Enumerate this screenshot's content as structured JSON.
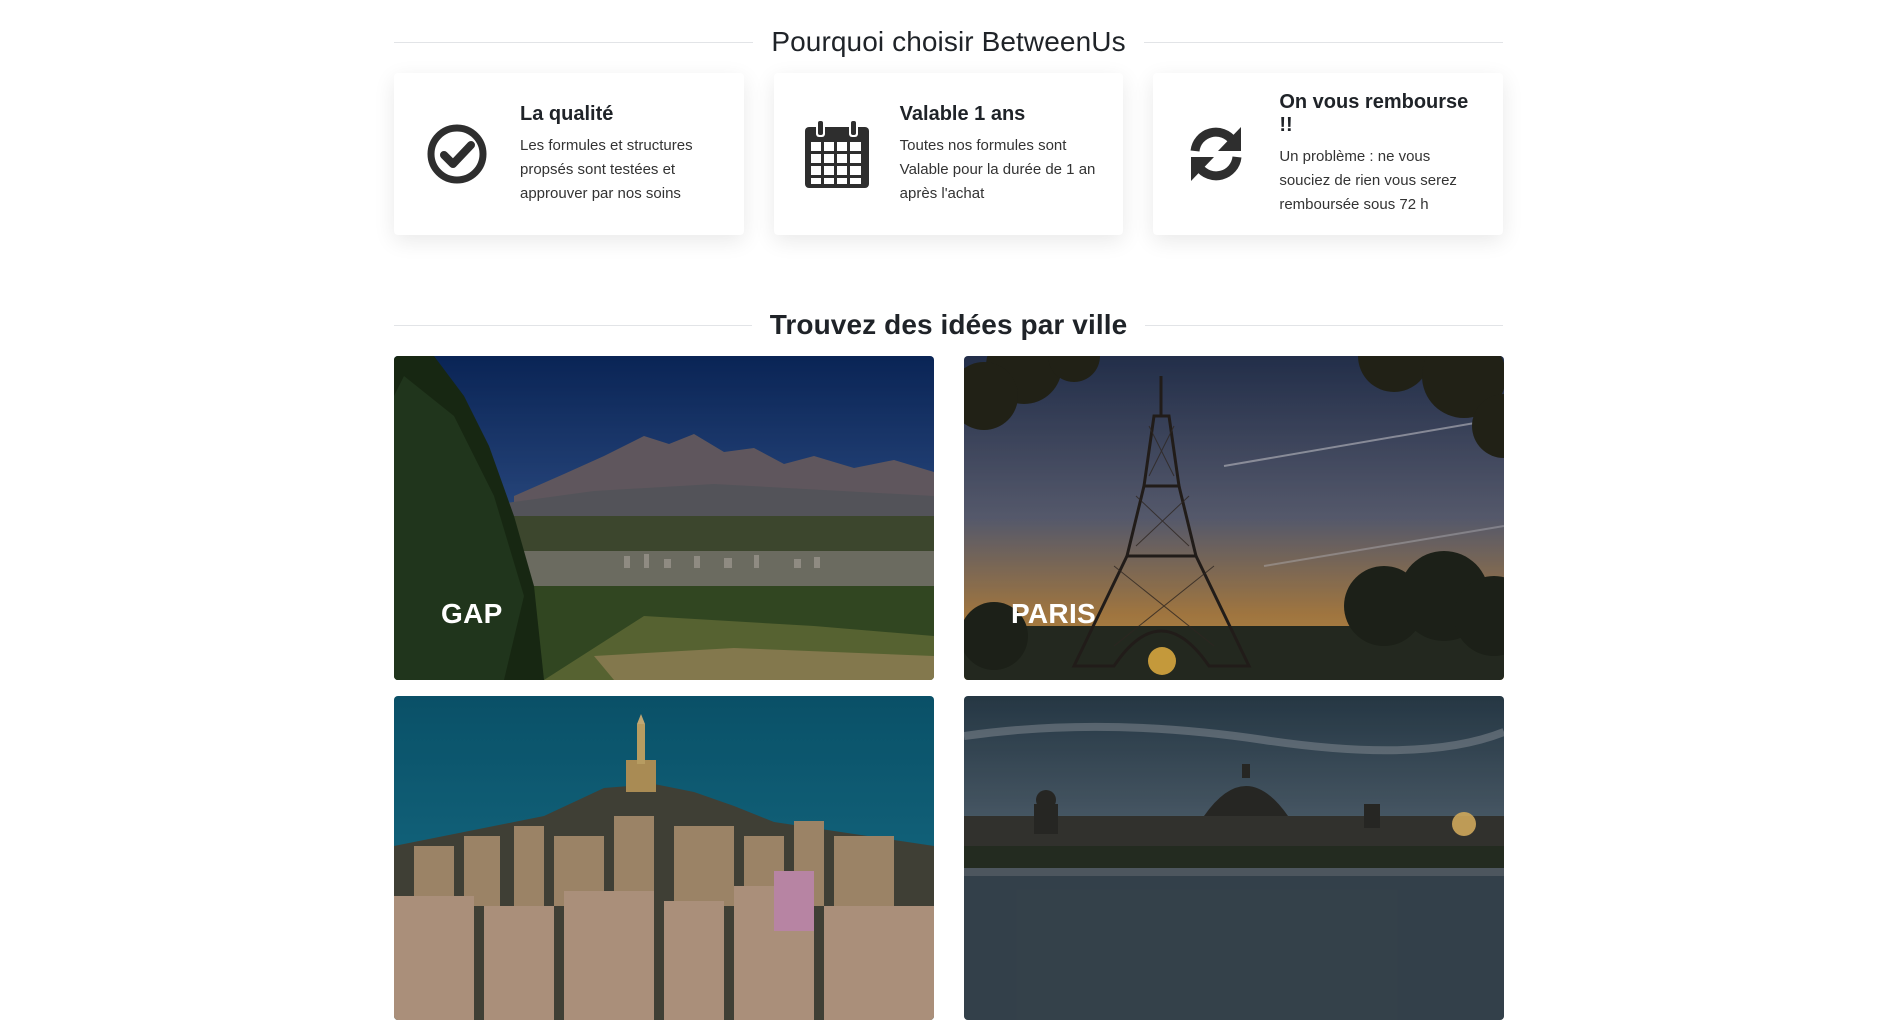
{
  "why": {
    "title": "Pourquoi choisir BetweenUs",
    "features": [
      {
        "icon": "check-circle-icon",
        "title": "La qualité",
        "text": "Les formules et structures propsés sont testées et approuver par nos soins"
      },
      {
        "icon": "calendar-icon",
        "title": "Valable 1 ans",
        "text": "Toutes nos formules sont Valable pour la durée de 1 an après l'achat"
      },
      {
        "icon": "refresh-icon",
        "title": "On vous rembourse !!",
        "text": "Un problème : ne vous souciez de rien vous serez remboursée sous 72 h"
      }
    ]
  },
  "cities_section": {
    "title": "Trouvez des idées par ville",
    "cities": [
      {
        "name": "GAP"
      },
      {
        "name": "PARIS"
      },
      {
        "name": ""
      },
      {
        "name": ""
      }
    ]
  },
  "colors": {
    "icon": "#2e2e2e",
    "rule": "#e2e4e7",
    "heading": "#1f2328"
  }
}
